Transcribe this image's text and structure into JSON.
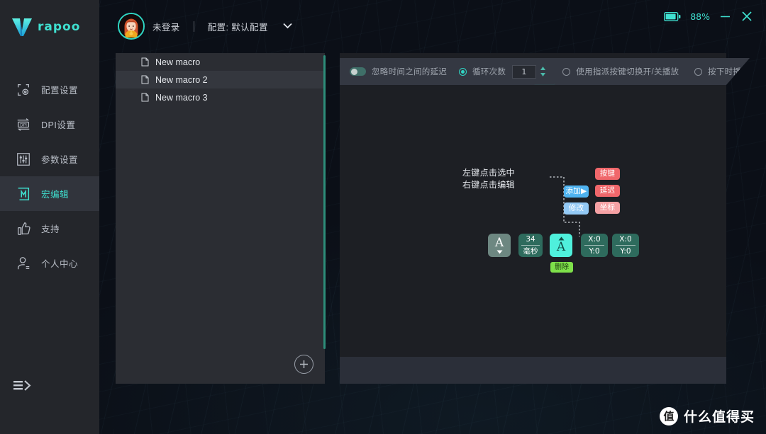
{
  "app": {
    "brand": "rapoo",
    "brand_color": "#3fe0d0"
  },
  "sidebar": {
    "items": [
      {
        "label": "配置设置",
        "icon": "profile-settings-icon",
        "active": false
      },
      {
        "label": "DPI设置",
        "icon": "dpi-icon",
        "active": false
      },
      {
        "label": "参数设置",
        "icon": "sliders-icon",
        "active": false
      },
      {
        "label": "宏编辑",
        "icon": "macro-icon",
        "active": true
      },
      {
        "label": "支持",
        "icon": "thumbs-up-icon",
        "active": false
      },
      {
        "label": "个人中心",
        "icon": "user-icon",
        "active": false
      }
    ],
    "collapse_icon": "collapse-menu-icon"
  },
  "header": {
    "avatar_icon": "user-avatar",
    "login_state": "未登录",
    "separator": "|",
    "profile_label": "配置: 默认配置",
    "dropdown_icon": "chevron-down-icon",
    "battery_icon": "battery-icon",
    "battery_percent": "88%",
    "minimize_icon": "minimize-icon",
    "close_icon": "close-icon"
  },
  "macro_list": {
    "items": [
      {
        "label": "New macro",
        "icon": "file-icon"
      },
      {
        "label": "New macro 2",
        "icon": "file-icon"
      },
      {
        "label": "New macro 3",
        "icon": "file-icon"
      }
    ],
    "add_button_icon": "plus-icon"
  },
  "toolbar": {
    "ignore_delay_label": "忽略时间之间的延迟",
    "ignore_delay_toggle_on": false,
    "loop_count_label": "循环次数",
    "loop_count_selected": true,
    "loop_count_value": "1",
    "spinner_icon": "spinner-up-down-icon",
    "toggle_play_label": "使用指派按键切换开/关播放",
    "toggle_play_selected": false,
    "hold_play_label": "按下时播放",
    "hold_play_selected": false
  },
  "canvas": {
    "hint_line1": "左键点击选中",
    "hint_line2": "右键点击编辑",
    "legend": [
      {
        "label": "添加",
        "style": "blue",
        "arrow": true
      },
      {
        "label": "修改",
        "style": "blue2",
        "arrow": false
      },
      {
        "label": "按键",
        "style": "red",
        "arrow": false
      },
      {
        "label": "延迟",
        "style": "red2b",
        "arrow": false
      },
      {
        "label": "坐标",
        "style": "red2",
        "arrow": false
      }
    ],
    "blocks": [
      {
        "type": "key-up",
        "letter": "A",
        "sub": "",
        "marker": "down",
        "style": "grey"
      },
      {
        "type": "delay",
        "top": "34",
        "sub": "毫秒",
        "marker": "",
        "style": "dark"
      },
      {
        "type": "key-down",
        "letter": "A",
        "sub": "",
        "marker": "up",
        "style": "highlight"
      },
      {
        "type": "coord",
        "top": "X:0",
        "sub": "Y:0",
        "marker": "",
        "style": "dark"
      },
      {
        "type": "coord",
        "top": "X:0",
        "sub": "Y:0",
        "marker": "",
        "style": "dark"
      }
    ],
    "delete_label": "删除"
  },
  "watermark": {
    "logo_char": "值",
    "text": "什么值得买"
  }
}
